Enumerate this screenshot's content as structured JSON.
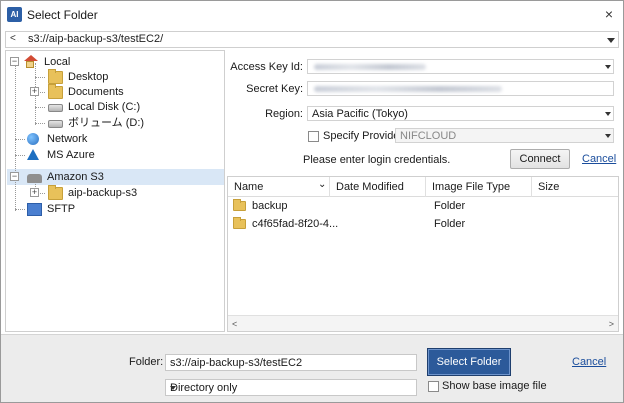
{
  "window": {
    "title": "Select Folder",
    "app_icon_text": "AI",
    "close_glyph": "×"
  },
  "pathbar": {
    "back_glyph": "<",
    "path": "s3://aip-backup-s3/testEC2/"
  },
  "tree": {
    "items": [
      {
        "label": "Local",
        "icon": "home-icon"
      },
      {
        "label": "Desktop",
        "icon": "folder-icon"
      },
      {
        "label": "Documents",
        "icon": "folder-icon"
      },
      {
        "label": "Local Disk (C:)",
        "icon": "disk-icon"
      },
      {
        "label": "ボリューム (D:)",
        "icon": "disk-icon"
      },
      {
        "label": "Network",
        "icon": "network-icon"
      },
      {
        "label": "MS Azure",
        "icon": "azure-icon"
      },
      {
        "label": "Amazon S3",
        "icon": "s3-icon",
        "selected": true
      },
      {
        "label": "aip-backup-s3",
        "icon": "folder-icon"
      },
      {
        "label": "SFTP",
        "icon": "sftp-icon"
      }
    ]
  },
  "s3": {
    "access_key_label": "Access Key Id:",
    "secret_key_label": "Secret Key:",
    "region_label": "Region:",
    "region_value": "Asia Pacific (Tokyo)",
    "specify_provider_label": "Specify Provider",
    "provider_value": "NIFCLOUD",
    "login_message": "Please enter login credentials.",
    "connect_label": "Connect",
    "cancel_label": "Cancel"
  },
  "filelist": {
    "columns": [
      "Name",
      "Date Modified",
      "Image File Type",
      "Size"
    ],
    "sort_glyph": "⌄",
    "rows": [
      {
        "name": "backup",
        "type": "Folder"
      },
      {
        "name": "c4f65fad-8f20-4...",
        "type": "Folder"
      }
    ],
    "scroll_left": "<",
    "scroll_right": ">"
  },
  "footer": {
    "folder_label": "Folder:",
    "folder_value": "s3://aip-backup-s3/testEC2",
    "select_button": "Select Folder",
    "cancel_link": "Cancel",
    "directory_option": "Directory only",
    "show_base_label": "Show base image file"
  },
  "colors": {
    "accent": "#2c5a9a",
    "selection": "#d9e7f6",
    "link": "#1a4d9c"
  }
}
